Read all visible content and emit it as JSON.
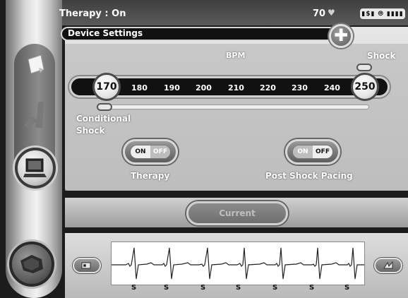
{
  "status": {
    "therapy": "Therapy : On",
    "heart_rate": "70",
    "heart_icon": "heart-icon",
    "battery_text": "▮$▮ ⦾ ▮▮▮▮"
  },
  "header": {
    "title": "Device Settings",
    "add_icon": "plus-icon"
  },
  "scale": {
    "bpm_label": "BPM",
    "shock_label": "Shock",
    "ticks": [
      "180",
      "190",
      "200",
      "210",
      "220",
      "230",
      "240"
    ],
    "conditional_value": "170",
    "shock_value": "250",
    "conditional_label_line1": "Conditional",
    "conditional_label_line2": "Shock"
  },
  "toggles": {
    "therapy": {
      "label": "Therapy",
      "on": "ON",
      "off": "OFF",
      "state": "on"
    },
    "post_shock": {
      "label": "Post Shock Pacing",
      "on": "ON",
      "off": "OFF",
      "state": "off"
    }
  },
  "current_button": "Current",
  "ecg": {
    "markers": [
      "S",
      "S",
      "S",
      "S",
      "S",
      "S",
      "S"
    ]
  },
  "sidebar": {
    "items": [
      {
        "icon": "note-icon"
      },
      {
        "icon": "patient-icon"
      },
      {
        "icon": "monitor-icon",
        "selected": true
      },
      {
        "icon": "device-icon"
      }
    ]
  }
}
